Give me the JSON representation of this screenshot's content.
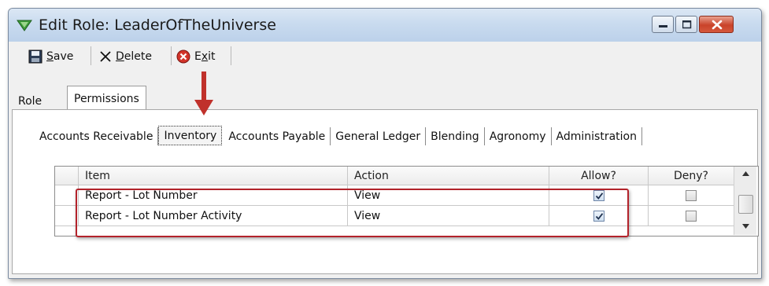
{
  "window": {
    "title": "Edit Role: LeaderOfTheUniverse",
    "icons": {
      "app": "green-triangle-icon",
      "minimize": "minimize-icon",
      "maximize": "maximize-icon",
      "close": "close-icon"
    }
  },
  "toolbar": {
    "save_label": "Save",
    "delete_label": "Delete",
    "exit_label": "Exit",
    "save_icon": "floppy-disk-icon",
    "delete_icon": "x-icon",
    "exit_icon": "red-x-circle-icon"
  },
  "main_tabs": [
    {
      "label": "Role",
      "active": false
    },
    {
      "label": "Permissions",
      "active": true
    }
  ],
  "module_tabs": [
    {
      "label": "Accounts Receivable",
      "active": false
    },
    {
      "label": "Inventory",
      "active": true
    },
    {
      "label": "Accounts Payable",
      "active": false
    },
    {
      "label": "General Ledger",
      "active": false
    },
    {
      "label": "Blending",
      "active": false
    },
    {
      "label": "Agronomy",
      "active": false
    },
    {
      "label": "Administration",
      "active": false
    }
  ],
  "grid": {
    "columns": [
      "Item",
      "Action",
      "Allow?",
      "Deny?"
    ],
    "rows": [
      {
        "item": "Report - Lot Number",
        "action": "View",
        "allow": true,
        "deny": false
      },
      {
        "item": "Report - Lot Number Activity",
        "action": "View",
        "allow": true,
        "deny": false
      }
    ]
  },
  "colors": {
    "highlight": "#b3232b",
    "arrow": "#c0312b",
    "title_bar": "#c9dbef"
  }
}
